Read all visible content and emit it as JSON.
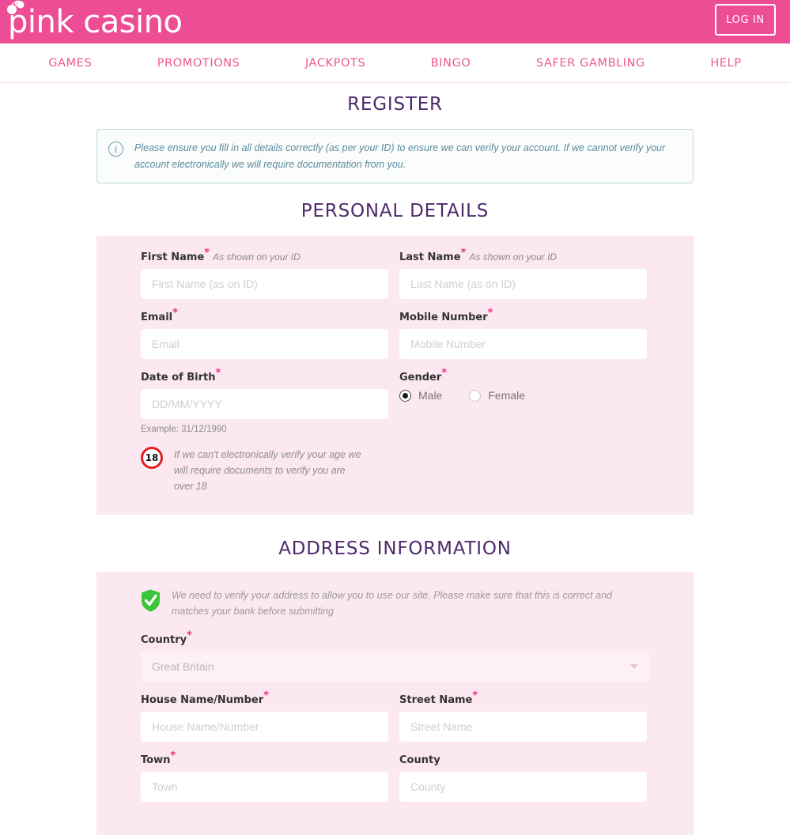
{
  "header": {
    "logo_text": "pink casino",
    "logo_icon": "cherries-heart-icon",
    "login_label": "LOG IN"
  },
  "nav": {
    "items": [
      {
        "label": "GAMES",
        "name": "nav-item-games"
      },
      {
        "label": "PROMOTIONS",
        "name": "nav-item-promotions"
      },
      {
        "label": "JACKPOTS",
        "name": "nav-item-jackpots"
      },
      {
        "label": "BINGO",
        "name": "nav-item-bingo"
      },
      {
        "label": "SAFER GAMBLING",
        "name": "nav-item-safer-gambling"
      },
      {
        "label": "HELP",
        "name": "nav-item-help"
      }
    ]
  },
  "page": {
    "title": "REGISTER",
    "info_banner": {
      "icon": "info-circle-icon",
      "text": "Please ensure you fill in all details correctly (as per your ID) to ensure we can verify your account. If we cannot verify your account electronically we will require documentation from you."
    }
  },
  "personal_details": {
    "title": "PERSONAL DETAILS",
    "first_name": {
      "label": "First Name",
      "required_mark": "*",
      "hint": "As shown on your ID",
      "placeholder": "First Name (as on ID)",
      "value": ""
    },
    "last_name": {
      "label": "Last Name",
      "required_mark": "*",
      "hint": "As shown on your ID",
      "placeholder": "Last Name (as on ID)",
      "value": ""
    },
    "email": {
      "label": "Email",
      "required_mark": "*",
      "placeholder": "Email",
      "value": ""
    },
    "mobile": {
      "label": "Mobile Number",
      "required_mark": "*",
      "placeholder": "Mobile Number",
      "value": ""
    },
    "dob": {
      "label": "Date of Birth",
      "required_mark": "*",
      "placeholder": "DD/MM/YYYY",
      "value": "",
      "example": "Example: 31/12/1990"
    },
    "gender": {
      "label": "Gender",
      "required_mark": "*",
      "options": [
        {
          "label": "Male",
          "selected": true
        },
        {
          "label": "Female",
          "selected": false
        }
      ]
    },
    "age_note": {
      "badge": "18",
      "badge_icon": "age-18-icon",
      "text": "If we can't electronically verify your age we will require documents to verify you are over 18"
    }
  },
  "address_information": {
    "title": "ADDRESS INFORMATION",
    "shield_note": {
      "icon": "shield-check-icon",
      "text": "We need to verify your address to allow you to use our site. Please make sure that this is correct and matches your bank before submitting"
    },
    "country": {
      "label": "Country",
      "required_mark": "*",
      "selected": "Great Britain",
      "dropdown_icon": "chevron-down-icon"
    },
    "house": {
      "label": "House Name/Number",
      "required_mark": "*",
      "placeholder": "House Name/Number",
      "value": ""
    },
    "street": {
      "label": "Street Name",
      "required_mark": "*",
      "placeholder": "Street Name",
      "value": ""
    },
    "town": {
      "label": "Town",
      "required_mark": "*",
      "placeholder": "Town",
      "value": ""
    },
    "county": {
      "label": "County",
      "required_mark": "",
      "placeholder": "County",
      "value": ""
    }
  },
  "colors": {
    "brand_pink": "#ec4d94",
    "nav_pink": "#f0568f",
    "panel_pink": "#fce8f1",
    "heading_purple": "#4e2a6b",
    "required_pink": "#e8337b",
    "info_teal": "#5c8b9c",
    "shield_green": "#3cc33c",
    "age_red": "#e02020"
  }
}
